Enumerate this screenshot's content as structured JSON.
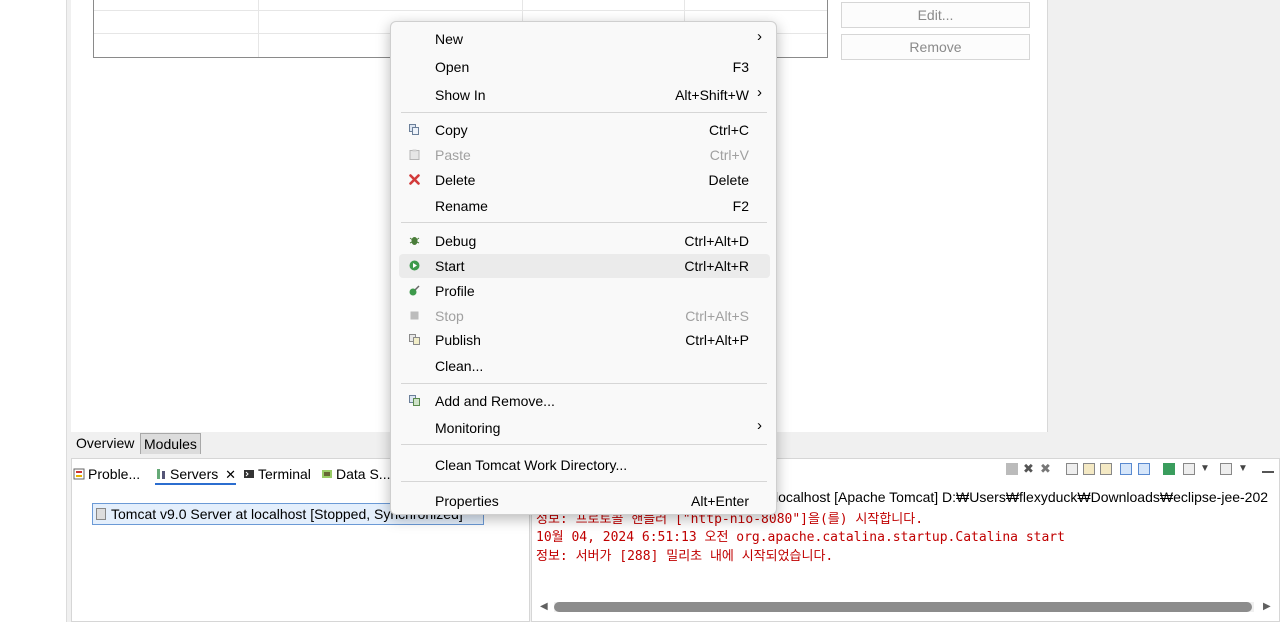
{
  "editor": {
    "side_buttons": {
      "edit": "Edit...",
      "remove": "Remove"
    },
    "tabs": [
      {
        "label": "Overview",
        "active": false
      },
      {
        "label": "Modules",
        "active": true
      }
    ]
  },
  "servers_view": {
    "tabs": [
      {
        "label": "Proble...",
        "icon": "problems-icon",
        "active": false
      },
      {
        "label": "Servers",
        "icon": "servers-icon",
        "active": true,
        "close": "✕"
      },
      {
        "label": "Terminal",
        "icon": "terminal-icon",
        "active": false
      },
      {
        "label": "Data S...",
        "icon": "data-source-icon",
        "active": false
      }
    ],
    "server_row": "Tomcat v9.0 Server at localhost  [Stopped, Synchronized]"
  },
  "console_view": {
    "title": "localhost [Apache Tomcat] D:₩Users₩flexyduck₩Downloads₩eclipse-jee-202",
    "lines": [
      "정보: 프로토콜 핸들러 [\"http-nio-8080\"]을(를) 시작합니다.",
      "10월 04, 2024 6:51:13 오전 org.apache.catalina.startup.Catalina start",
      "정보: 서버가 [288] 밀리초 내에 시작되었습니다."
    ],
    "colors": {
      "error_text": "#c00000"
    }
  },
  "context_menu": {
    "items": [
      {
        "label": "New",
        "shortcut": "",
        "submenu": "›",
        "icon": "",
        "disabled": false
      },
      {
        "label": "Open",
        "shortcut": "F3",
        "submenu": "",
        "icon": "",
        "disabled": false
      },
      {
        "label": "Show In",
        "shortcut": "Alt+Shift+W",
        "submenu": "›",
        "icon": "",
        "disabled": false
      },
      {
        "label": "Copy",
        "shortcut": "Ctrl+C",
        "submenu": "",
        "icon": "copy-icon",
        "disabled": false
      },
      {
        "label": "Paste",
        "shortcut": "Ctrl+V",
        "submenu": "",
        "icon": "paste-icon",
        "disabled": true
      },
      {
        "label": "Delete",
        "shortcut": "Delete",
        "submenu": "",
        "icon": "delete-icon",
        "disabled": false
      },
      {
        "label": "Rename",
        "shortcut": "F2",
        "submenu": "",
        "icon": "",
        "disabled": false
      },
      {
        "label": "Debug",
        "shortcut": "Ctrl+Alt+D",
        "submenu": "",
        "icon": "debug-icon",
        "disabled": false
      },
      {
        "label": "Start",
        "shortcut": "Ctrl+Alt+R",
        "submenu": "",
        "icon": "start-icon",
        "disabled": false,
        "hover": true
      },
      {
        "label": "Profile",
        "shortcut": "",
        "submenu": "",
        "icon": "profile-icon",
        "disabled": false
      },
      {
        "label": "Stop",
        "shortcut": "Ctrl+Alt+S",
        "submenu": "",
        "icon": "stop-icon",
        "disabled": true
      },
      {
        "label": "Publish",
        "shortcut": "Ctrl+Alt+P",
        "submenu": "",
        "icon": "publish-icon",
        "disabled": false
      },
      {
        "label": "Clean...",
        "shortcut": "",
        "submenu": "",
        "icon": "",
        "disabled": false
      },
      {
        "label": "Add and Remove...",
        "shortcut": "",
        "submenu": "",
        "icon": "add-remove-icon",
        "disabled": false
      },
      {
        "label": "Monitoring",
        "shortcut": "",
        "submenu": "›",
        "icon": "",
        "disabled": false
      },
      {
        "label": "Clean Tomcat Work Directory...",
        "shortcut": "",
        "submenu": "",
        "icon": "",
        "disabled": false
      },
      {
        "label": "Properties",
        "shortcut": "Alt+Enter",
        "submenu": "",
        "icon": "",
        "disabled": false
      }
    ]
  }
}
